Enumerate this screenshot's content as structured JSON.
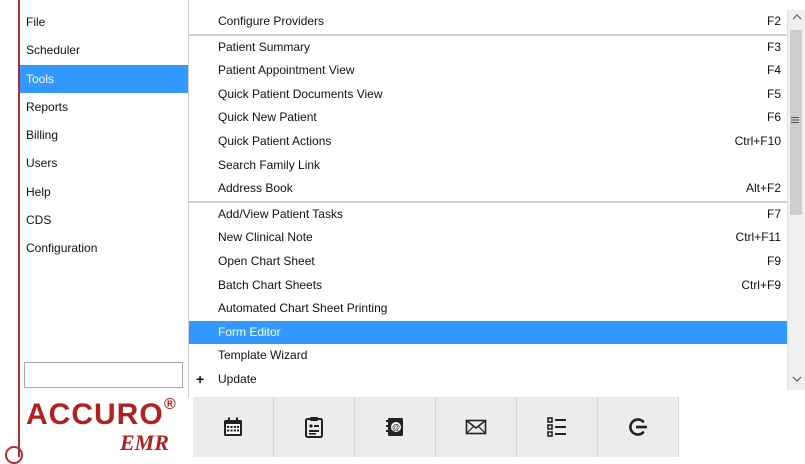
{
  "left_menu": {
    "items": [
      {
        "label": "File"
      },
      {
        "label": "Scheduler"
      },
      {
        "label": "Tools"
      },
      {
        "label": "Reports"
      },
      {
        "label": "Billing"
      },
      {
        "label": "Users"
      },
      {
        "label": "Help"
      },
      {
        "label": "CDS"
      },
      {
        "label": "Configuration"
      }
    ],
    "active": "Tools"
  },
  "search": {
    "value": "",
    "placeholder": ""
  },
  "logo": {
    "main": "ACCURO",
    "reg": "®",
    "sub": "EMR"
  },
  "tools_menu": {
    "group1": [
      {
        "label": "Configure Providers",
        "shortcut": "F2"
      }
    ],
    "group2": [
      {
        "label": "Patient Summary",
        "shortcut": "F3"
      },
      {
        "label": "Patient Appointment View",
        "shortcut": "F4"
      },
      {
        "label": "Quick Patient Documents View",
        "shortcut": "F5"
      },
      {
        "label": "Quick New Patient",
        "shortcut": "F6"
      },
      {
        "label": "Quick Patient Actions",
        "shortcut": "Ctrl+F10"
      },
      {
        "label": "Search Family Link",
        "shortcut": ""
      },
      {
        "label": "Address Book",
        "shortcut": "Alt+F2"
      }
    ],
    "group3": [
      {
        "label": "Add/View Patient Tasks",
        "shortcut": "F7"
      },
      {
        "label": "New Clinical Note",
        "shortcut": "Ctrl+F11"
      },
      {
        "label": "Open Chart Sheet",
        "shortcut": "F9"
      },
      {
        "label": "Batch Chart Sheets",
        "shortcut": "Ctrl+F9"
      },
      {
        "label": "Automated Chart Sheet Printing",
        "shortcut": ""
      },
      {
        "label": "Form Editor",
        "shortcut": ""
      },
      {
        "label": "Template Wizard",
        "shortcut": ""
      },
      {
        "label": "Update",
        "shortcut": "",
        "expand": "+"
      }
    ],
    "active": "Form Editor"
  },
  "toolbar": {
    "icons": [
      "scheduler-calendar-icon",
      "patient-chart-icon",
      "address-book-icon",
      "messages-envelope-icon",
      "task-list-icon",
      "logout-icon"
    ]
  },
  "colors": {
    "selection": "#3399ff",
    "brand": "#b22020"
  }
}
